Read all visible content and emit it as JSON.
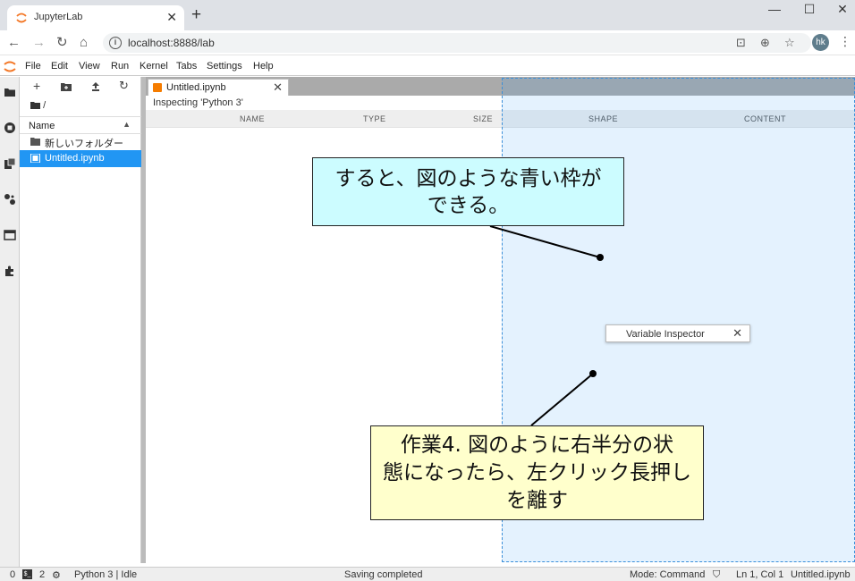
{
  "browser": {
    "tab_title": "JupyterLab",
    "tab_close": "✕",
    "new_tab": "+",
    "url": "localhost:8888/lab",
    "avatar": "hk"
  },
  "jupyter": {
    "menu": [
      "File",
      "Edit",
      "View",
      "Run",
      "Kernel",
      "Tabs",
      "Settings",
      "Help"
    ],
    "filebrowser": {
      "path": "/",
      "header": "Name",
      "items": [
        {
          "label": "新しいフォルダー",
          "type": "folder"
        },
        {
          "label": "Untitled.ipynb",
          "type": "notebook"
        }
      ]
    },
    "dock": {
      "tab_title": "Untitled.ipynb",
      "inspecting": "Inspecting 'Python 3'",
      "columns": [
        "NAME",
        "TYPE",
        "SIZE",
        "SHAPE",
        "CONTENT"
      ]
    },
    "drag_tab": {
      "title": "Variable Inspector",
      "close": "✕"
    },
    "status": {
      "zero": "0",
      "terminals": "2",
      "kernel": "Python 3 | Idle",
      "saving": "Saving completed",
      "mode": "Mode: Command",
      "position": "Ln 1, Col 1",
      "file": "Untitled.ipynb"
    }
  },
  "annotations": {
    "callout1": {
      "line1": "すると、図のような青い枠が",
      "line2": "できる。"
    },
    "callout2": {
      "line1": "作業4. 図のように右半分の状",
      "line2": "態になったら、左クリック長押し",
      "line3": "を離す"
    }
  },
  "colors": {
    "accent": "#2196f3",
    "callout1_bg": "#ccfcff",
    "callout2_bg": "#ffffcc",
    "jupyter_orange": "#f37726"
  }
}
